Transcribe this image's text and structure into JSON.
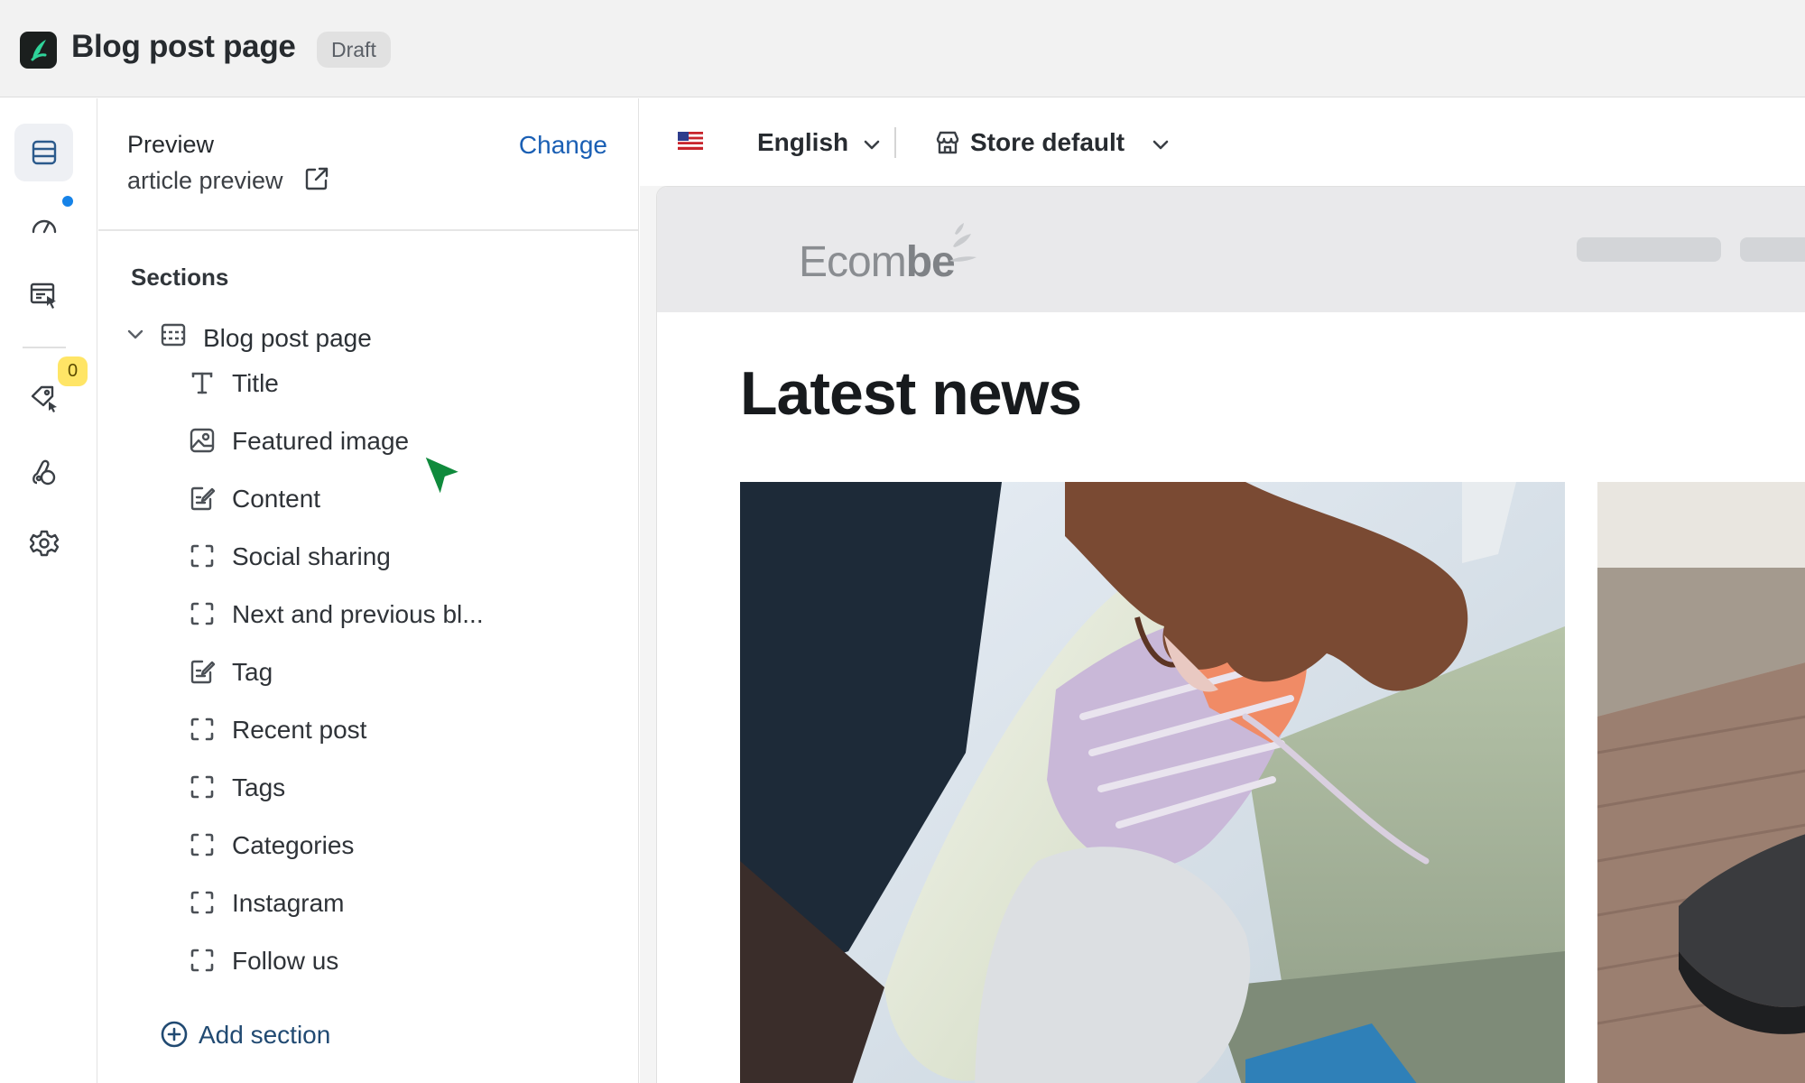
{
  "header": {
    "title": "Blog post page",
    "status_badge": "Draft"
  },
  "rail": {
    "items": [
      {
        "icon": "sections-icon",
        "active": true
      },
      {
        "icon": "speed-icon",
        "has_dot": true
      },
      {
        "icon": "pages-icon"
      },
      {
        "icon": "tag-icon",
        "badge": "0"
      },
      {
        "icon": "theme-icon"
      },
      {
        "icon": "gear-icon"
      }
    ]
  },
  "panel": {
    "preview_label": "Preview",
    "preview_value": "article preview",
    "change_label": "Change",
    "sections_heading": "Sections",
    "root_section": "Blog post page",
    "sections": [
      {
        "label": "Title",
        "icon": "text-icon"
      },
      {
        "label": "Featured image",
        "icon": "image-icon"
      },
      {
        "label": "Content",
        "icon": "edit-icon"
      },
      {
        "label": "Social sharing",
        "icon": "block-icon"
      },
      {
        "label": "Next and previous bl...",
        "icon": "block-icon"
      },
      {
        "label": "Tag",
        "icon": "edit-icon"
      },
      {
        "label": "Recent post",
        "icon": "block-icon"
      },
      {
        "label": "Tags",
        "icon": "block-icon"
      },
      {
        "label": "Categories",
        "icon": "block-icon"
      },
      {
        "label": "Instagram",
        "icon": "block-icon"
      },
      {
        "label": "Follow us",
        "icon": "block-icon"
      }
    ],
    "add_section_label": "Add section"
  },
  "toolbar": {
    "language": "English",
    "store": "Store default"
  },
  "preview": {
    "logo_light": "Ecom",
    "logo_bold": "be",
    "heading": "Latest news"
  },
  "colors": {
    "accent": "#1a5fb4",
    "notification_dot": "#1683e8",
    "badge": "#ffe566",
    "cursor": "#0f8a3c"
  }
}
